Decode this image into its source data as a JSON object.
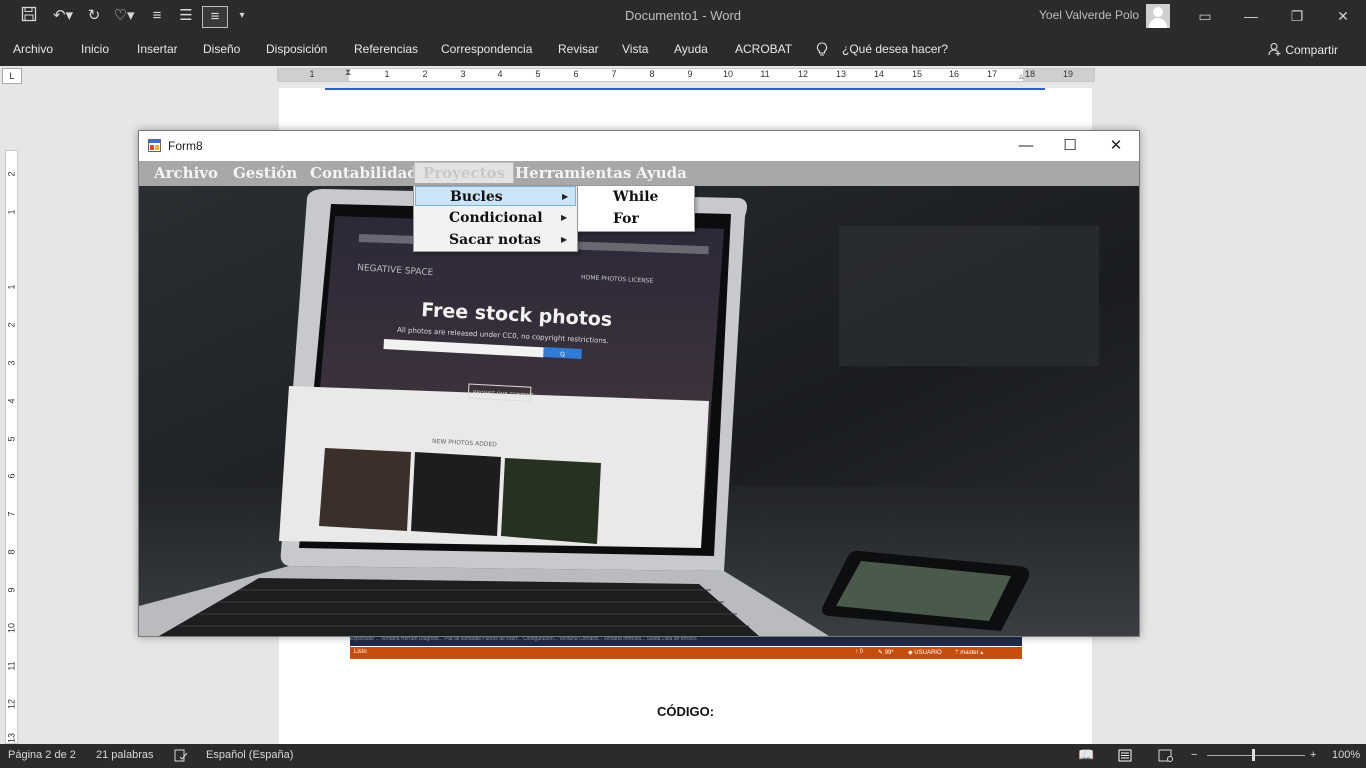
{
  "word": {
    "window_title": "Documento1  -  Word",
    "user_name": "Yoel Valverde Polo",
    "ribbon_tabs": [
      "Archivo",
      "Inicio",
      "Insertar",
      "Diseño",
      "Disposición",
      "Referencias",
      "Correspondencia",
      "Revisar",
      "Vista",
      "Ayuda",
      "ACROBAT"
    ],
    "tell_me": "¿Qué desea hacer?",
    "share": "Compartir",
    "horizontal_ruler_labels": [
      "1",
      "1",
      "2",
      "3",
      "4",
      "5",
      "6",
      "7",
      "8",
      "9",
      "10",
      "11",
      "12",
      "13",
      "14",
      "15",
      "16",
      "17",
      "18",
      "19"
    ],
    "vertical_ruler_labels": [
      "2",
      "1",
      "1",
      "2",
      "3",
      "4",
      "5",
      "6",
      "7",
      "8",
      "9",
      "10",
      "11",
      "12",
      "13"
    ],
    "tab_selector": "L",
    "document": {
      "heading_text": "CÓDIGO:",
      "embedded_strip_top": "Explorador ...   Ventana Herram   Diagnóst...   Pila de llamadas   Puntos de interr...   Configuración...   Ventana Comand...   Ventana Inmedia...   Salida   Lista de errores",
      "embedded_strip_status": {
        "left": "Listo",
        "items": [
          "↑ 0",
          "✎ 99*",
          "◆ USUARIO",
          "ᛘ master ▴"
        ]
      }
    },
    "status": {
      "page": "Página 2 de 2",
      "words": "21 palabras",
      "language": "Español (España)",
      "zoom": "100%",
      "zoom_minus": "−",
      "zoom_plus": "+"
    }
  },
  "form": {
    "title": "Form8",
    "menu": [
      "Archivo",
      "Gestión",
      "Contabilidad",
      "Proyectos",
      "Herramientas",
      "Ayuda"
    ],
    "proyectos_items": [
      "Bucles",
      "Condicional",
      "Sacar notas"
    ],
    "bucles_items": [
      "While",
      "For"
    ],
    "image": {
      "headline": "Free stock photos",
      "subline": "All photos are released under CC0, no copyright restrictions.",
      "brand": "NEGATIVE SPACE",
      "nav": "HOME   PHOTOS   LICENSE",
      "button": "BROWSE OUR CONTENT",
      "section": "NEW PHOTOS ADDED",
      "search_button": "Q"
    }
  },
  "colors": {
    "word_chrome": "#2b2b2b",
    "form_menubar": "#a8a8a8",
    "menu_highlight": "#cce4f7",
    "vs_status_orange": "#c74d0d"
  }
}
